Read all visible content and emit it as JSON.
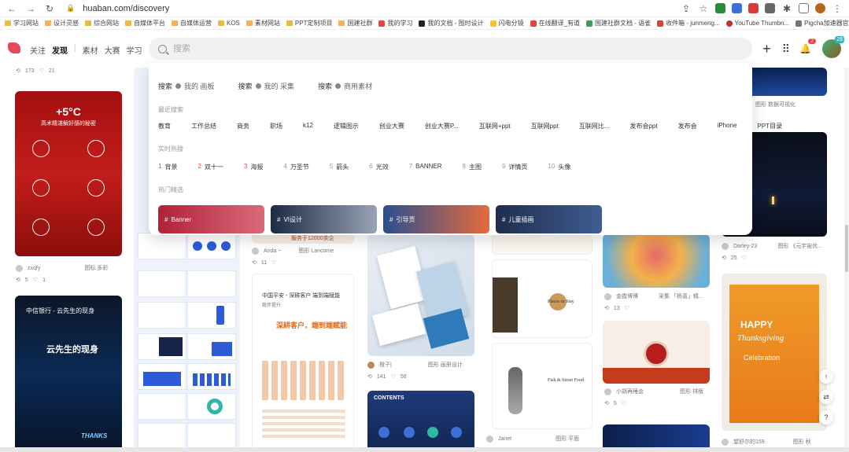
{
  "browser": {
    "url": "huaban.com/discovery",
    "bookmarks": [
      "学习网站",
      "设计灵感",
      "综合网站",
      "自媒体平台",
      "自媒体运营",
      "KOS",
      "素材网站",
      "PPT定制项目",
      "国建社群",
      "我的学习",
      "我的文档 - 图时设计",
      "闪电分镜",
      "在线翻译_有道",
      "国建社群文档 - 语雀",
      "收件箱 - junmeng...",
      "YouTube Thumbn...",
      "Pigcha加速器官网"
    ]
  },
  "header": {
    "nav": [
      "关注",
      "发现",
      "素材",
      "大赛",
      "学习"
    ],
    "active": "发现",
    "notif_count": "2",
    "avatar_badge": "28"
  },
  "search": {
    "placeholder": "搜索",
    "scopes": [
      {
        "label": "搜索",
        "sub": "我的 画板"
      },
      {
        "label": "搜索",
        "sub": "我的 采集"
      },
      {
        "label": "搜索",
        "sub": "商用素材"
      }
    ],
    "recent_title": "最近搜索",
    "recent": [
      "教育",
      "工作总结",
      "商务",
      "职场",
      "k12",
      "逻辑图示",
      "创业大赛",
      "创业大赛P...",
      "互联网+ppt",
      "互联网ppt",
      "互联网比...",
      "发布会ppt",
      "发布会",
      "iPhone",
      "PPT目录"
    ],
    "hot_title": "实时热搜",
    "hot": [
      {
        "rank": "1",
        "word": "背景"
      },
      {
        "rank": "2",
        "word": "双十一"
      },
      {
        "rank": "3",
        "word": "海报"
      },
      {
        "rank": "4",
        "word": "万圣节"
      },
      {
        "rank": "5",
        "word": "箭头"
      },
      {
        "rank": "6",
        "word": "光效"
      },
      {
        "rank": "7",
        "word": "BANNER"
      },
      {
        "rank": "8",
        "word": "主图"
      },
      {
        "rank": "9",
        "word": "详情页"
      },
      {
        "rank": "10",
        "word": "头像"
      }
    ],
    "picks_title": "热门精选",
    "picks": [
      {
        "label": "Banner",
        "color1": "#b2213a",
        "color2": "#d96a7a"
      },
      {
        "label": "VI设计",
        "color1": "#1d2a44",
        "color2": "#9aa3b5"
      },
      {
        "label": "引导页",
        "color1": "#2a4f8f",
        "color2": "#e66a3c"
      },
      {
        "label": "儿童插画",
        "color1": "#1f2d4d",
        "color2": "#3f5d92"
      }
    ]
  },
  "pins": {
    "p1": {
      "title": "+5°C",
      "subtitle": "高术精湛解好感的秘密",
      "user": "zxqfy",
      "board": "图标 多彩",
      "saves": "5",
      "likes": "1",
      "top_saves": "173",
      "top_likes": "21"
    },
    "p2": {
      "title": "中信银行 - 云先生的现身",
      "sub": "云先生的现身",
      "user": "",
      "caption": "THANKS"
    },
    "p3": {
      "user": "Anda ~",
      "board": "图形 Lancome",
      "saves": "11",
      "banner": "服务于12000余企",
      "title": "中国平安 - 深耕客户 端到端赋能",
      "sub": "稳步提升",
      "headline": "深耕客户，端到端赋能"
    },
    "p4": {
      "user": "橙子|",
      "board": "图形 画册设计",
      "saves": "141",
      "likes": "56",
      "contents": "CONTENTS"
    },
    "p5": {
      "places": "Places to Stay",
      "fish": "Fish & Street Food",
      "user": "Janet",
      "board": "图形 平面"
    },
    "p6": {
      "user": "金霞博博",
      "board": "采集 「杨喜」精...",
      "saves": "13",
      "user2": "小胡再睡会",
      "board2": "图形 排版",
      "saves2": "5"
    },
    "p7": {
      "user": "Darley-23",
      "board": "图形 《元宇宙优...",
      "saves": "25",
      "board_top": "图形 数据可视化",
      "happy": "HAPPY",
      "thanks": "Thanksgiving",
      "celebration": "Celebration",
      "user2": "望舒尔的159",
      "board2": "图形 秋"
    }
  }
}
